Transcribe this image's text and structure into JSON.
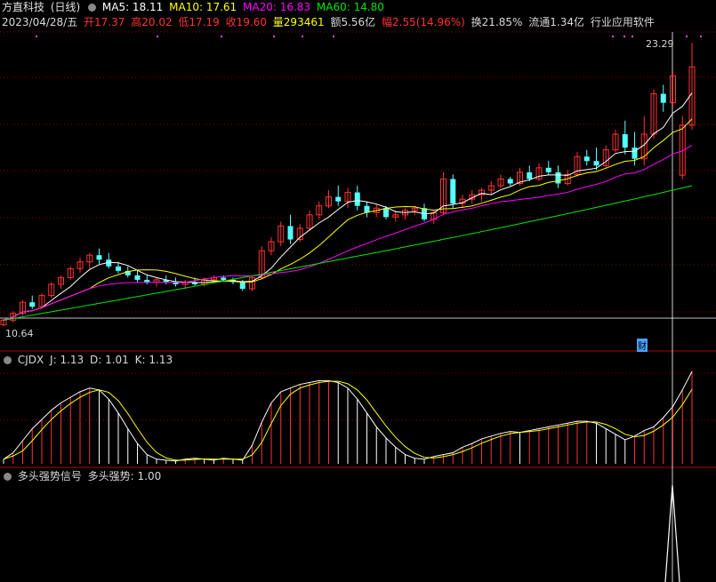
{
  "header1": {
    "stock_name": "方直科技",
    "period": "(日线)",
    "ma5": "MA5: 18.11",
    "ma10": "MA10: 17.61",
    "ma20": "MA20: 16.83",
    "ma60": "MA60: 14.80"
  },
  "header2": {
    "date": "2023/04/28/五",
    "open": "开17.37",
    "high": "高20.02",
    "low": "低17.19",
    "close": "收19.60",
    "volume": "量293461",
    "amount": "额5.56亿",
    "change": "幅2.55(14.96%)",
    "turnover": "换21.85%",
    "float": "流通1.34亿",
    "industry": "行业应用软件"
  },
  "price_labels": {
    "high_mark": "23.29",
    "low_mark": "10.64",
    "note": "财"
  },
  "cjdx": {
    "title": "CJDX",
    "j": "J: 1.13",
    "d": "D: 1.01",
    "k": "K: 1.13"
  },
  "signal": {
    "title": "多头强势信号",
    "value": "多头强势: 1.00"
  },
  "colors": {
    "up": "#ff3232",
    "down": "#54ffff",
    "ma5": "#ffffff",
    "ma10": "#ffff00",
    "ma20": "#ff00ff",
    "ma60": "#00e600",
    "grid": "#8b0000"
  },
  "chart_data": {
    "type": "candlestick",
    "price_range": [
      10.64,
      23.29
    ],
    "candles": [
      {
        "o": 10.7,
        "h": 11.0,
        "l": 10.64,
        "c": 10.9
      },
      {
        "o": 10.9,
        "h": 11.3,
        "l": 10.8,
        "c": 11.2
      },
      {
        "o": 11.2,
        "h": 11.8,
        "l": 11.1,
        "c": 11.7
      },
      {
        "o": 11.7,
        "h": 12.0,
        "l": 11.4,
        "c": 11.5
      },
      {
        "o": 11.5,
        "h": 12.1,
        "l": 11.4,
        "c": 12.0
      },
      {
        "o": 12.0,
        "h": 12.6,
        "l": 11.9,
        "c": 12.5
      },
      {
        "o": 12.5,
        "h": 12.9,
        "l": 12.3,
        "c": 12.8
      },
      {
        "o": 12.8,
        "h": 13.3,
        "l": 12.7,
        "c": 13.2
      },
      {
        "o": 13.2,
        "h": 13.7,
        "l": 13.0,
        "c": 13.5
      },
      {
        "o": 13.5,
        "h": 13.9,
        "l": 13.2,
        "c": 13.8
      },
      {
        "o": 13.8,
        "h": 14.1,
        "l": 13.4,
        "c": 13.6
      },
      {
        "o": 13.6,
        "h": 13.9,
        "l": 13.2,
        "c": 13.3
      },
      {
        "o": 13.3,
        "h": 13.5,
        "l": 13.0,
        "c": 13.1
      },
      {
        "o": 13.1,
        "h": 13.3,
        "l": 12.8,
        "c": 12.9
      },
      {
        "o": 12.9,
        "h": 13.1,
        "l": 12.6,
        "c": 12.7
      },
      {
        "o": 12.7,
        "h": 12.9,
        "l": 12.5,
        "c": 12.6
      },
      {
        "o": 12.6,
        "h": 12.8,
        "l": 12.4,
        "c": 12.7
      },
      {
        "o": 12.7,
        "h": 12.9,
        "l": 12.5,
        "c": 12.6
      },
      {
        "o": 12.6,
        "h": 12.8,
        "l": 12.4,
        "c": 12.5
      },
      {
        "o": 12.5,
        "h": 12.7,
        "l": 12.3,
        "c": 12.6
      },
      {
        "o": 12.6,
        "h": 12.8,
        "l": 12.4,
        "c": 12.5
      },
      {
        "o": 12.5,
        "h": 12.8,
        "l": 12.4,
        "c": 12.7
      },
      {
        "o": 12.7,
        "h": 12.9,
        "l": 12.6,
        "c": 12.8
      },
      {
        "o": 12.8,
        "h": 12.9,
        "l": 12.6,
        "c": 12.7
      },
      {
        "o": 12.7,
        "h": 12.8,
        "l": 12.5,
        "c": 12.6
      },
      {
        "o": 12.6,
        "h": 12.7,
        "l": 12.2,
        "c": 12.3
      },
      {
        "o": 12.3,
        "h": 12.9,
        "l": 12.2,
        "c": 12.8
      },
      {
        "o": 12.8,
        "h": 14.2,
        "l": 12.7,
        "c": 14.0
      },
      {
        "o": 14.0,
        "h": 14.6,
        "l": 13.8,
        "c": 14.4
      },
      {
        "o": 14.4,
        "h": 15.3,
        "l": 14.2,
        "c": 15.1
      },
      {
        "o": 15.1,
        "h": 15.6,
        "l": 14.3,
        "c": 14.5
      },
      {
        "o": 14.5,
        "h": 15.2,
        "l": 14.4,
        "c": 15.0
      },
      {
        "o": 15.0,
        "h": 15.8,
        "l": 14.9,
        "c": 15.6
      },
      {
        "o": 15.6,
        "h": 16.2,
        "l": 15.4,
        "c": 16.0
      },
      {
        "o": 16.0,
        "h": 16.7,
        "l": 15.9,
        "c": 16.4
      },
      {
        "o": 16.4,
        "h": 16.9,
        "l": 16.0,
        "c": 16.2
      },
      {
        "o": 16.2,
        "h": 16.8,
        "l": 15.9,
        "c": 16.6
      },
      {
        "o": 16.6,
        "h": 16.9,
        "l": 15.8,
        "c": 16.0
      },
      {
        "o": 16.0,
        "h": 16.2,
        "l": 15.5,
        "c": 15.7
      },
      {
        "o": 15.7,
        "h": 16.1,
        "l": 15.5,
        "c": 15.9
      },
      {
        "o": 15.9,
        "h": 16.0,
        "l": 15.4,
        "c": 15.5
      },
      {
        "o": 15.5,
        "h": 15.8,
        "l": 15.3,
        "c": 15.6
      },
      {
        "o": 15.6,
        "h": 15.9,
        "l": 15.4,
        "c": 15.8
      },
      {
        "o": 15.8,
        "h": 16.0,
        "l": 15.6,
        "c": 15.9
      },
      {
        "o": 15.9,
        "h": 16.1,
        "l": 15.3,
        "c": 15.4
      },
      {
        "o": 15.4,
        "h": 15.8,
        "l": 15.2,
        "c": 15.7
      },
      {
        "o": 15.7,
        "h": 17.5,
        "l": 15.6,
        "c": 17.2
      },
      {
        "o": 17.2,
        "h": 17.4,
        "l": 15.9,
        "c": 16.1
      },
      {
        "o": 16.1,
        "h": 16.5,
        "l": 15.9,
        "c": 16.3
      },
      {
        "o": 16.3,
        "h": 16.7,
        "l": 16.1,
        "c": 16.5
      },
      {
        "o": 16.5,
        "h": 16.8,
        "l": 16.2,
        "c": 16.7
      },
      {
        "o": 16.7,
        "h": 17.1,
        "l": 16.5,
        "c": 16.9
      },
      {
        "o": 16.9,
        "h": 17.4,
        "l": 16.8,
        "c": 17.2
      },
      {
        "o": 17.2,
        "h": 17.3,
        "l": 16.9,
        "c": 17.0
      },
      {
        "o": 17.0,
        "h": 17.7,
        "l": 16.9,
        "c": 17.5
      },
      {
        "o": 17.5,
        "h": 17.8,
        "l": 17.1,
        "c": 17.2
      },
      {
        "o": 17.2,
        "h": 17.9,
        "l": 17.1,
        "c": 17.7
      },
      {
        "o": 17.7,
        "h": 18.0,
        "l": 17.4,
        "c": 17.5
      },
      {
        "o": 17.5,
        "h": 17.8,
        "l": 16.8,
        "c": 17.0
      },
      {
        "o": 17.0,
        "h": 17.6,
        "l": 16.9,
        "c": 17.4
      },
      {
        "o": 17.4,
        "h": 18.4,
        "l": 17.3,
        "c": 18.2
      },
      {
        "o": 18.2,
        "h": 18.5,
        "l": 17.8,
        "c": 18.0
      },
      {
        "o": 18.0,
        "h": 18.6,
        "l": 17.6,
        "c": 17.8
      },
      {
        "o": 17.8,
        "h": 18.7,
        "l": 17.7,
        "c": 18.5
      },
      {
        "o": 18.5,
        "h": 19.4,
        "l": 18.4,
        "c": 19.2
      },
      {
        "o": 19.2,
        "h": 19.8,
        "l": 18.3,
        "c": 18.6
      },
      {
        "o": 18.6,
        "h": 19.3,
        "l": 17.8,
        "c": 18.1
      },
      {
        "o": 18.1,
        "h": 20.0,
        "l": 17.8,
        "c": 19.2
      },
      {
        "o": 19.2,
        "h": 21.2,
        "l": 19.0,
        "c": 21.0
      },
      {
        "o": 21.0,
        "h": 21.4,
        "l": 20.2,
        "c": 20.6
      },
      {
        "o": 20.6,
        "h": 22.0,
        "l": 20.4,
        "c": 21.8
      },
      {
        "o": 17.37,
        "h": 20.02,
        "l": 17.19,
        "c": 19.6
      },
      {
        "o": 19.6,
        "h": 23.29,
        "l": 19.4,
        "c": 22.2
      }
    ],
    "cjdx_k": [
      0.05,
      0.12,
      0.25,
      0.38,
      0.48,
      0.58,
      0.66,
      0.72,
      0.78,
      0.82,
      0.8,
      0.7,
      0.55,
      0.38,
      0.22,
      0.1,
      0.05,
      0.04,
      0.03,
      0.05,
      0.06,
      0.05,
      0.04,
      0.06,
      0.05,
      0.04,
      0.2,
      0.45,
      0.66,
      0.78,
      0.82,
      0.86,
      0.88,
      0.9,
      0.9,
      0.88,
      0.82,
      0.7,
      0.55,
      0.4,
      0.28,
      0.18,
      0.1,
      0.06,
      0.05,
      0.08,
      0.1,
      0.12,
      0.18,
      0.22,
      0.27,
      0.3,
      0.33,
      0.35,
      0.34,
      0.36,
      0.38,
      0.4,
      0.42,
      0.44,
      0.46,
      0.46,
      0.44,
      0.38,
      0.32,
      0.26,
      0.3,
      0.36,
      0.4,
      0.5,
      0.62,
      0.8,
      1.0
    ]
  }
}
